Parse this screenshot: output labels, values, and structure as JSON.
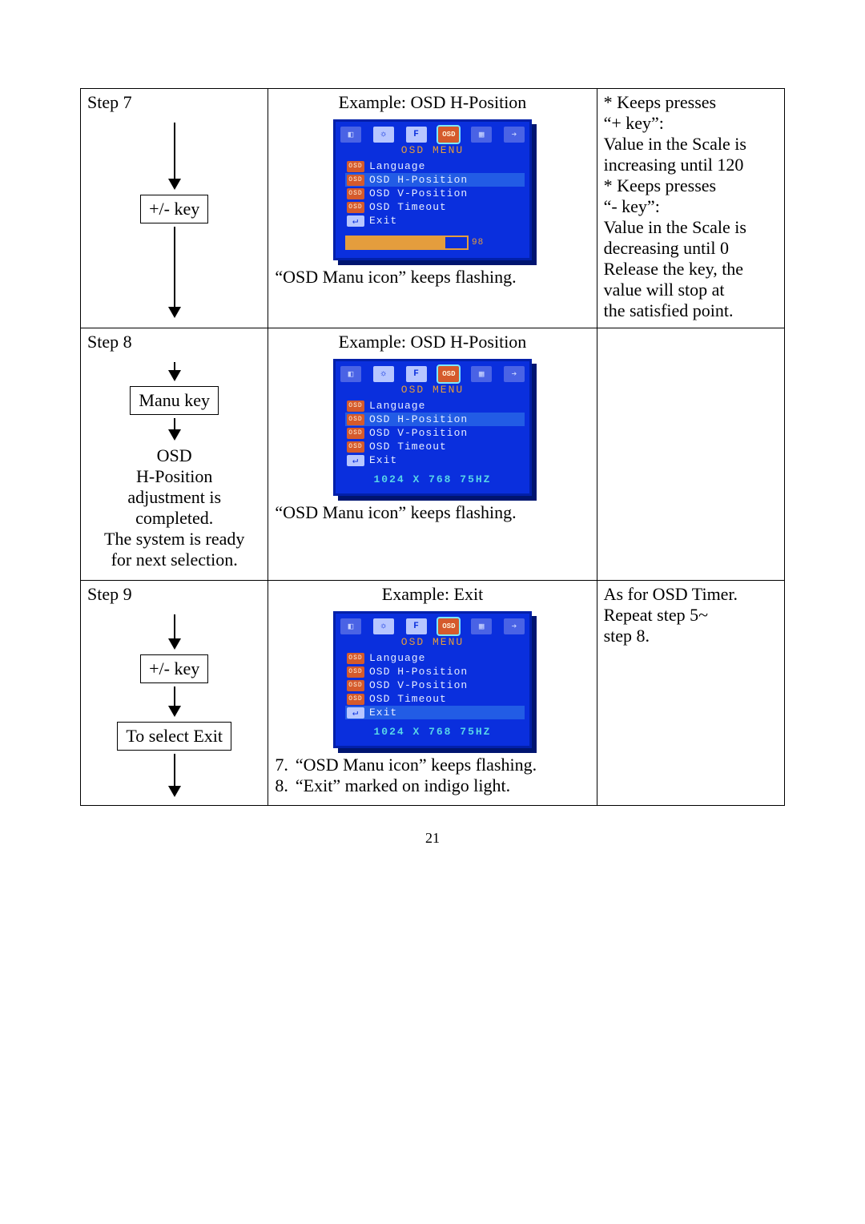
{
  "page_number": "21",
  "osd_common": {
    "header": "OSD  MENU",
    "items": {
      "lang": "Language",
      "hpos": "OSD H-Position",
      "vpos": "OSD V-Position",
      "timeout": "OSD Timeout",
      "exit": "Exit"
    },
    "badge": "OSD",
    "resolution": "1024 X 768 75HZ"
  },
  "row7": {
    "step": "Step 7",
    "flow_key": "+/-  key",
    "example_title": "Example: OSD H-Position",
    "gauge_value": "98",
    "gauge_pct": 82,
    "caption": "“OSD Manu icon” keeps flashing.",
    "right": [
      "* Keeps presses",
      "“+ key”:",
      "Value in the Scale is",
      "increasing until 120",
      "* Keeps presses",
      "“- key”:",
      "Value in the Scale is",
      "decreasing until 0",
      "Release the key, the",
      "value will stop at",
      "the satisfied point."
    ]
  },
  "row8": {
    "step": "Step 8",
    "flow_key": "Manu key",
    "flow_text": "OSD\nH-Position adjustment is completed.\nThe system is ready for next selection.",
    "example_title": "Example: OSD H-Position",
    "caption": "“OSD Manu icon” keeps flashing.",
    "right": ""
  },
  "row9": {
    "step": "Step 9",
    "flow_key": "+/- key",
    "flow_key2": "To select Exit",
    "example_title": "Example: Exit",
    "caption1_no": "7.",
    "caption1": "“OSD Manu icon” keeps flashing.",
    "caption2_no": "8.",
    "caption2": "“Exit” marked on indigo light.",
    "right": [
      "As for OSD Timer.",
      "Repeat step 5~",
      "step 8."
    ]
  }
}
